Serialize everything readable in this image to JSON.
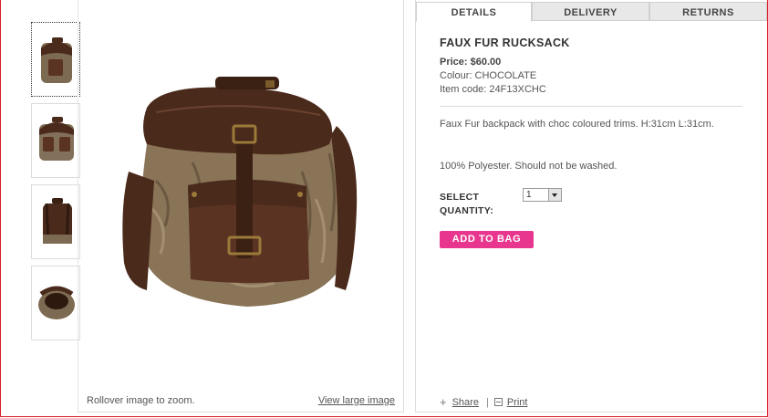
{
  "tabs": [
    {
      "label": "DETAILS",
      "active": true
    },
    {
      "label": "DELIVERY",
      "active": false
    },
    {
      "label": "RETURNS",
      "active": false
    }
  ],
  "product": {
    "title": "FAUX FUR RUCKSACK",
    "price": "Price: $60.00",
    "colour": "Colour: CHOCOLATE",
    "item_code": "Item code: 24F13XCHC",
    "description": "Faux Fur backpack with choc coloured trims. H:31cm L:31cm.",
    "care": "100% Polyester. Should not be washed."
  },
  "quantity": {
    "label": "SELECT QUANTITY:",
    "value": "1"
  },
  "actions": {
    "add_to_bag": "ADD TO BAG",
    "share": "Share",
    "separator": "|",
    "print": "Print"
  },
  "image_panel": {
    "zoom_hint": "Rollover image to zoom.",
    "view_large": "View large image"
  },
  "thumbnails": [
    {
      "name": "front-view",
      "selected": true
    },
    {
      "name": "front-closeup",
      "selected": false
    },
    {
      "name": "back-view",
      "selected": false
    },
    {
      "name": "top-view",
      "selected": false
    }
  ],
  "colors": {
    "accent": "#e8358e",
    "frame_border": "#d7202a",
    "leather": "#4a2a1b",
    "fur": "#8a7458"
  }
}
